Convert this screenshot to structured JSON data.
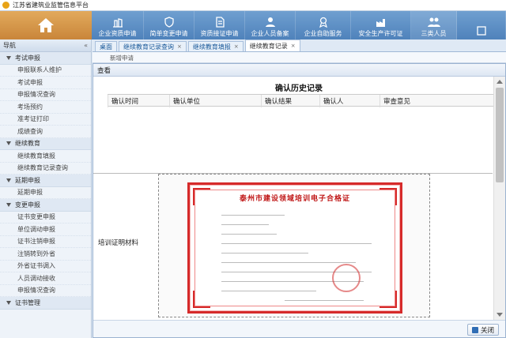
{
  "app": {
    "title": "江苏省建筑业监管信息平台"
  },
  "topnav": {
    "items": [
      {
        "label": "企业资质申请",
        "icon": "building-crane-icon"
      },
      {
        "label": "简单变更申请",
        "icon": "leaf-shield-icon"
      },
      {
        "label": "资质接证申请",
        "icon": "document-icon"
      },
      {
        "label": "企业人员备案",
        "icon": "person-icon"
      },
      {
        "label": "企业自助服务",
        "icon": "ribbon-icon"
      },
      {
        "label": "安全生产许可证",
        "icon": "factory-icon"
      },
      {
        "label": "三类人员",
        "icon": "people-icon"
      }
    ]
  },
  "sidebar": {
    "title": "导航",
    "collapse": "«",
    "groups": [
      {
        "label": "考试申报",
        "items": [
          "申报联系人维护",
          "考试申报",
          "申报情况查询",
          "考场预约",
          "准考证打印",
          "成绩查询"
        ]
      },
      {
        "label": "继续教育",
        "items": [
          "继续教育填报",
          "继续教育记录查询"
        ]
      },
      {
        "label": "延期申报",
        "items": [
          "延期申报"
        ]
      },
      {
        "label": "变更申报",
        "items": [
          "证书变更申报",
          "单位调动申报",
          "证书注销申报",
          "注销转到外省",
          "外省证书调入",
          "人员调动接收",
          "申报情况查询"
        ]
      },
      {
        "label": "证书管理",
        "items": []
      }
    ]
  },
  "tabs": [
    {
      "label": "桌面",
      "closable": false
    },
    {
      "label": "继续教育记录查询",
      "closable": true
    },
    {
      "label": "继续教育填报",
      "closable": true
    },
    {
      "label": "继续教育记录",
      "closable": true
    }
  ],
  "toolbar": {
    "new_label": "新增申请"
  },
  "dialog": {
    "title": "查看",
    "section_title": "确认历史记录",
    "history_columns": [
      "确认时间",
      "确认单位",
      "确认结果",
      "确认人",
      "审查意见"
    ],
    "attachment_label": "培训证明材料",
    "certificate_title": "泰州市建设领域培训电子合格证",
    "close_label": "关闭"
  },
  "colors": {
    "nav_blue": "#4f82bb",
    "home_orange": "#d9963f",
    "cert_red": "#d62a2a"
  }
}
